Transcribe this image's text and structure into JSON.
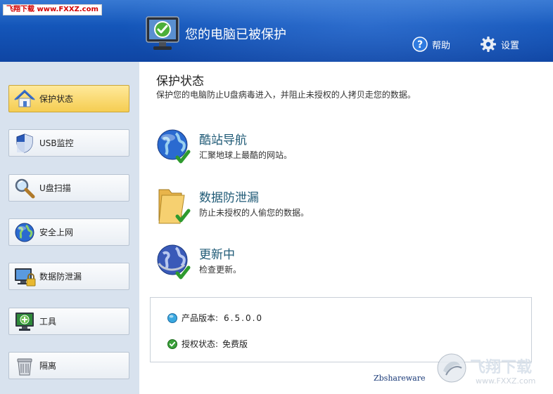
{
  "watermark_top": "飞翔下载 www.FXXZ.com",
  "header": {
    "status_title": "您的电脑已被保护",
    "help_label": "帮助",
    "settings_label": "设置"
  },
  "sidebar": {
    "items": [
      {
        "label": "保护状态",
        "icon": "house-shield-icon",
        "active": true
      },
      {
        "label": "USB监控",
        "icon": "shield-icon",
        "active": false
      },
      {
        "label": "U盘扫描",
        "icon": "magnifier-icon",
        "active": false
      },
      {
        "label": "安全上网",
        "icon": "globe-icon",
        "active": false
      },
      {
        "label": "数据防泄漏",
        "icon": "monitor-lock-icon",
        "active": false
      },
      {
        "label": "工具",
        "icon": "monitor-tools-icon",
        "active": false
      },
      {
        "label": "隔离",
        "icon": "trash-bin-icon",
        "active": false
      }
    ]
  },
  "main": {
    "title": "保护状态",
    "subtitle": "保护您的电脑防止U盘病毒进入，并阻止未授权的人拷贝走您的数据。",
    "features": [
      {
        "title": "酷站导航",
        "desc": "汇聚地球上最酷的网站。",
        "icon": "globe-check-icon"
      },
      {
        "title": "数据防泄漏",
        "desc": "防止未授权的人偷您的数据。",
        "icon": "folder-check-icon"
      },
      {
        "title": "更新中",
        "desc": "检查更新。",
        "icon": "globe-update-check-icon"
      }
    ],
    "info": {
      "version_label": "产品版本:",
      "version_value": "6.5.0.0",
      "license_label": "授权状态:",
      "license_value": "免费版"
    },
    "footer_link": "Zbshareware"
  },
  "watermark_logo": {
    "cn": "飞翔下载",
    "url": "www.FXXZ.com"
  },
  "colors": {
    "header_blue": "#1455b8",
    "sidebar_bg": "#d8e2ee",
    "active_item": "#f5cd52",
    "feature_title": "#1f5a76"
  }
}
